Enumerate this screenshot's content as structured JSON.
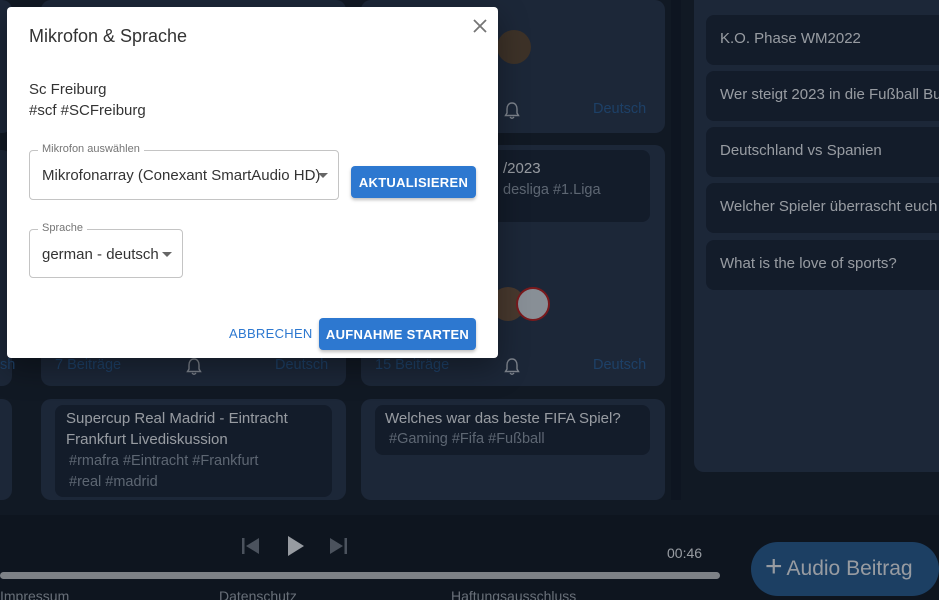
{
  "dialog": {
    "title": "Mikrofon & Sprache",
    "topic_name": "Sc Freiburg",
    "topic_tags": "#scf #SCFreiburg",
    "mic_label": "Mikrofon auswählen",
    "mic_value": "Mikrofonarray (Conexant SmartAudio HD)",
    "refresh_label": "AKTUALISIEREN",
    "lang_label": "Sprache",
    "lang_value": "german - deutsch",
    "cancel_label": "ABBRECHEN",
    "start_label": "AUFNAHME STARTEN"
  },
  "background": {
    "card_mid_top": {
      "meta_lang": "Deutsch"
    },
    "card_mid_2": {
      "title": "/2023",
      "tags": "desliga  #1.Liga"
    },
    "card_left_row2": {
      "meta_count": "7 Beiträge",
      "meta_lang": "Deutsch",
      "left_fragment": "sh"
    },
    "card_mid_row2": {
      "meta_count": "15 Beiträge",
      "meta_lang": "Deutsch"
    },
    "card_left_row3": {
      "title_line1": "Supercup Real Madrid - Eintracht",
      "title_line2": "Frankfurt Livediskussion",
      "tags_line1": "#rmafra  #Eintracht  #Frankfurt",
      "tags_line2": "#real  #madrid"
    },
    "card_mid_row3": {
      "title": "Welches war das beste FIFA Spiel?",
      "tags": "#Gaming  #Fifa  #Fußball"
    },
    "right_list": [
      "K.O. Phase WM2022",
      "Wer steigt 2023 in die Fußball Bu",
      "Deutschland vs Spanien",
      "Welcher Spieler überrascht euch",
      "What is the love of sports?"
    ]
  },
  "player": {
    "time": "00:46",
    "audio_button": "Audio Beitrag",
    "progress": 0.77
  },
  "footer": {
    "impressum": "Impressum",
    "datenschutz": "Datenschutz",
    "haftung": "Haftungsausschluss"
  }
}
